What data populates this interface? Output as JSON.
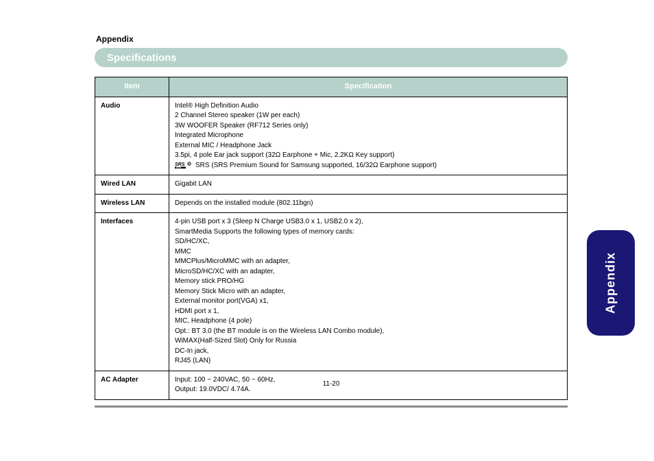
{
  "page_top_label": "Appendix",
  "banner_title": "Specifications",
  "tab_label": "Appendix",
  "page_number": "11-20",
  "table": {
    "headers": [
      "Item",
      "Specification"
    ],
    "rows": [
      {
        "item": "Audio",
        "spec_lines": [
          "Intel® High Definition Audio",
          "2 Channel Stereo speaker (1W per each)",
          "3W WOOFER Speaker (RF712 Series only)",
          "Integrated Microphone",
          "External MIC / Headphone Jack",
          "3.5pi, 4 pole Ear jack support (32Ω Earphone + Mic, 2.2KΩ Key support)",
          "SRS (SRS Premium Sound for Samsung supported, 16/32Ω Earphone support)"
        ],
        "srs_line_index": 6
      },
      {
        "item": "Wired LAN",
        "spec_lines": [
          "Gigabit LAN"
        ]
      },
      {
        "item": "Wireless LAN",
        "spec_lines": [
          "Depends on the installed module (802.11bgn)"
        ]
      },
      {
        "item": "Interfaces",
        "spec_lines": [
          "4-pin USB port x 3 (Sleep N Charge USB3.0 x 1, USB2.0 x 2),",
          "SmartMedia Supports the following types of memory cards:",
          "SD/HC/XC,",
          "MMC",
          "MMCPlus/MicroMMC with an adapter,",
          "MicroSD/HC/XC with an adapter,",
          "Memory stick PRO/HG",
          "Memory Stick Micro with an adapter,",
          "External monitor port(VGA) x1,",
          "HDMI port x 1,",
          "MIC, Headphone (4 pole)",
          "Opt.: BT 3.0 (the BT module is on the Wireless LAN Combo module),",
          "WiMAX(Half-Sized Slot) Only for Russia",
          "DC-In jack,",
          "RJ45 (LAN)"
        ]
      },
      {
        "item": "AC Adapter",
        "spec_lines": [
          "Input: 100 ~ 240VAC, 50 ~ 60Hz,",
          "Output: 19.0VDC/ 4.74A."
        ]
      }
    ]
  }
}
